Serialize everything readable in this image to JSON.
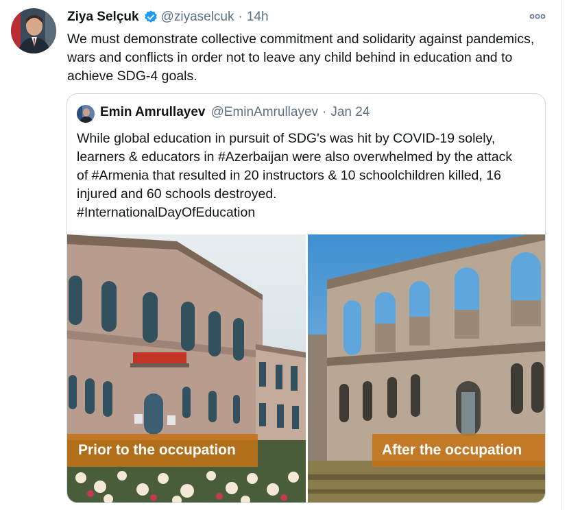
{
  "tweet": {
    "author_name": "Ziya Selçuk",
    "handle": "@ziyaselcuk",
    "separator": "·",
    "time": "14h",
    "text": "We must demonstrate collective commitment and solidarity against pandemics, wars and conflicts in order not to leave any child behind in education and to achieve SDG-4 goals.",
    "verified": true
  },
  "quote": {
    "author_name": "Emin Amrullayev",
    "handle": "@EminAmrullayev",
    "separator": "·",
    "date": "Jan 24",
    "lines": [
      "While global education in pursuit of SDG's was hit by COVID-19 solely,",
      "learners & educators in #Azerbaijan were also overwhelmed by the attack",
      "of #Armenia that resulted in 20 instructors & 10 schoolchildren killed, 16",
      "injured and 60 schools destroyed.",
      "#InternationalDayOfEducation"
    ],
    "media": {
      "left_caption": "Prior to the occupation",
      "right_caption": "After the occupation"
    }
  },
  "colors": {
    "text": "#0f1419",
    "secondary": "#5b7083",
    "verified": "#1d9bf0",
    "border": "#cfd9de",
    "caption_bg": "#c47216"
  },
  "icons": [
    "verified-badge-icon",
    "more-options-icon"
  ]
}
